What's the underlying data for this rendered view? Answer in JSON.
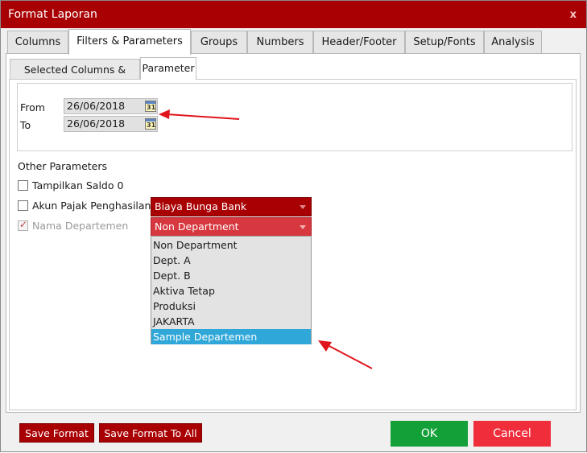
{
  "window": {
    "title": "Format Laporan",
    "close_glyph": "x"
  },
  "tabs": [
    {
      "label": "Columns"
    },
    {
      "label": "Filters &  Parameters"
    },
    {
      "label": "Groups"
    },
    {
      "label": "Numbers"
    },
    {
      "label": "Header/Footer"
    },
    {
      "label": "Setup/Fonts"
    },
    {
      "label": "Analysis"
    }
  ],
  "active_tab": "Filters &  Parameters",
  "subtabs": [
    {
      "label": "Selected Columns & Filters"
    },
    {
      "label": "Parameter"
    }
  ],
  "active_subtab": "Parameter",
  "dates": {
    "from_label": "From",
    "from_value": "26/06/2018",
    "to_label": "To",
    "to_value": "26/06/2018",
    "calendar_icon_text": "31"
  },
  "other_parameters": {
    "title": "Other Parameters",
    "tampilkan_saldo": {
      "label": "Tampilkan Saldo 0",
      "checked": false
    },
    "akun_pajak": {
      "label": "Akun Pajak Penghasilan",
      "checked": false,
      "combo_value": "Biaya Bunga Bank"
    },
    "nama_departemen": {
      "label": "Nama Departemen",
      "checked": true,
      "enabled": false,
      "combo_value": "Non Department",
      "check_glyph": "✓"
    }
  },
  "department_options": [
    "Non Department",
    "Dept. A",
    "Dept. B",
    "Aktiva Tetap",
    "Produksi",
    "JAKARTA",
    "Sample Departemen"
  ],
  "highlighted_option": "Sample Departemen",
  "footer": {
    "save_format": "Save Format",
    "save_format_all": "Save Format To All",
    "ok": "OK",
    "cancel": "Cancel"
  },
  "colors": {
    "brand": "#a90004",
    "combo_open": "#d7373f",
    "highlight": "#2fa7d8",
    "ok": "#14a038",
    "cancel": "#f02d3a",
    "annotation_arrow": "#e0161c"
  },
  "icons": [
    "close-icon",
    "calendar-icon",
    "checkbox-icon",
    "dropdown-arrow-icon",
    "annotation-arrow-icon"
  ]
}
